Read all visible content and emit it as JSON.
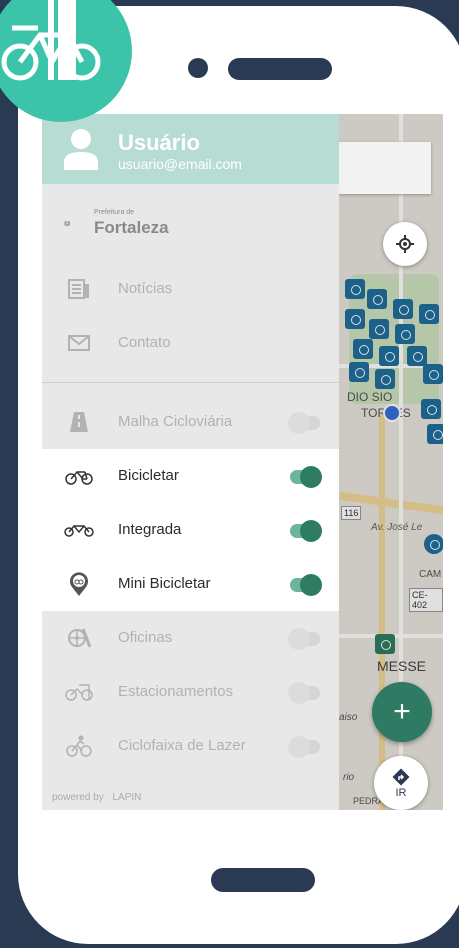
{
  "user": {
    "name": "Usuário",
    "email": "usuario@email.com"
  },
  "logo": {
    "small": "Prefeitura de",
    "big": "Fortaleza"
  },
  "menu": [
    {
      "label": "Notícias",
      "icon": "news-icon"
    },
    {
      "label": "Contato",
      "icon": "mail-icon"
    }
  ],
  "layers": [
    {
      "label": "Malha Cicloviária",
      "icon": "road-icon",
      "on": false
    },
    {
      "label": "Bicicletar",
      "icon": "bicycle-icon",
      "on": true
    },
    {
      "label": "Integrada",
      "icon": "tandem-bike-icon",
      "on": true
    },
    {
      "label": "Mini Bicicletar",
      "icon": "bike-pin-icon",
      "on": true
    },
    {
      "label": "Oficinas",
      "icon": "repair-wheel-icon",
      "on": false
    },
    {
      "label": "Estacionamentos",
      "icon": "bike-parking-icon",
      "on": false
    },
    {
      "label": "Ciclofaixa de Lazer",
      "icon": "cyclist-icon",
      "on": false
    }
  ],
  "footer": {
    "powered": "powered by",
    "brand": "LAPIN"
  },
  "map": {
    "labels": [
      "DIO SIO",
      "TORRES",
      "116",
      "Av. José Le",
      "CAM",
      "CE-402",
      "MESSE",
      "aiso",
      "rio",
      "PEDRA"
    ],
    "ir_label": "IR",
    "fab_plus": "+"
  },
  "colors": {
    "accent": "#2e7d63",
    "header": "#b7dcd3",
    "badge": "#3bc4a9",
    "frame": "#2a3a52"
  }
}
